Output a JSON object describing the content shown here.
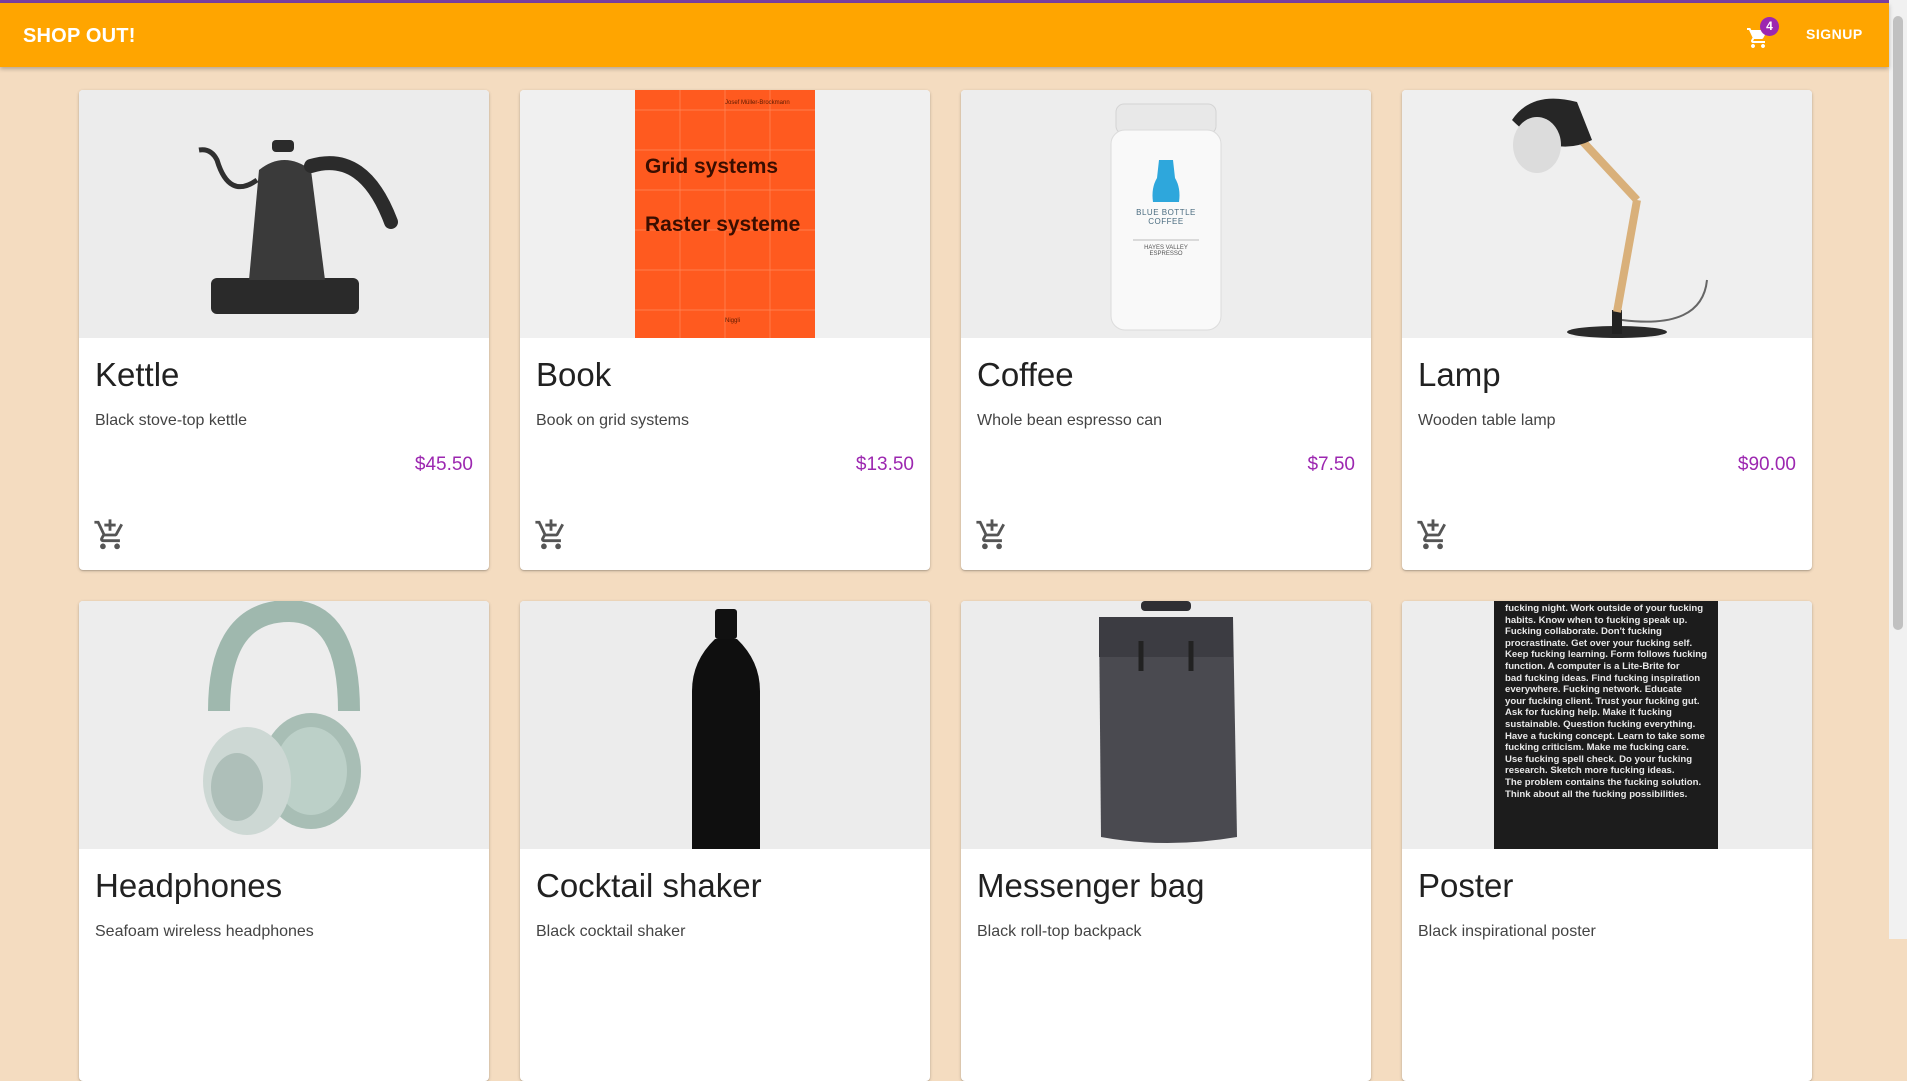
{
  "appbar": {
    "brand": "SHOP OUT!",
    "cart_count": "4",
    "signup_label": "SIGNUP",
    "color": "#ffa500"
  },
  "products": [
    {
      "title": "Kettle",
      "description": "Black stove-top kettle",
      "price": "$45.50",
      "image_icon": "kettle-image"
    },
    {
      "title": "Book",
      "description": "Book on grid systems",
      "price": "$13.50",
      "image_icon": "book-image",
      "cover_text": {
        "author": "Josef Müller-Brockmann",
        "line1": "Grid systems",
        "line2": "Raster systeme",
        "publisher": "Niggli"
      }
    },
    {
      "title": "Coffee",
      "description": "Whole bean espresso can",
      "price": "$7.50",
      "image_icon": "coffee-can-image",
      "label_text": {
        "brand": "BLUE BOTTLE COFFEE",
        "blend": "HAYES VALLEY ESPRESSO"
      }
    },
    {
      "title": "Lamp",
      "description": "Wooden table lamp",
      "price": "$90.00",
      "image_icon": "lamp-image"
    },
    {
      "title": "Headphones",
      "description": "Seafoam wireless headphones",
      "price": "",
      "image_icon": "headphones-image"
    },
    {
      "title": "Cocktail shaker",
      "description": "Black cocktail shaker",
      "price": "",
      "image_icon": "bottle-image"
    },
    {
      "title": "Messenger bag",
      "description": "Black roll-top backpack",
      "price": "",
      "image_icon": "backpack-image"
    },
    {
      "title": "Poster",
      "description": "Black inspirational poster",
      "price": "",
      "image_icon": "poster-image",
      "poster_lines": [
        "fucking night. Work outside of your fucking",
        "habits. Know when to fucking speak up.",
        "Fucking collaborate. Don't fucking",
        "procrastinate. Get over your fucking self.",
        "Keep fucking learning. Form follows fucking",
        "function. A computer is a Lite-Brite for",
        "bad fucking ideas. Find fucking inspiration",
        "everywhere. Fucking network. Educate",
        "your fucking client. Trust your fucking gut.",
        "Ask for fucking help. Make it fucking",
        "sustainable. Question fucking everything.",
        "Have a fucking concept. Learn to take some",
        "fucking criticism. Make me fucking care.",
        "Use fucking spell check. Do your fucking",
        "research. Sketch more fucking ideas.",
        "The problem contains the fucking solution.",
        "Think about all the fucking possibilities."
      ]
    }
  ],
  "price_color": "#9c27b0",
  "icons": {
    "cart": "shopping-cart-icon",
    "add_to_cart": "add-shopping-cart-icon"
  }
}
